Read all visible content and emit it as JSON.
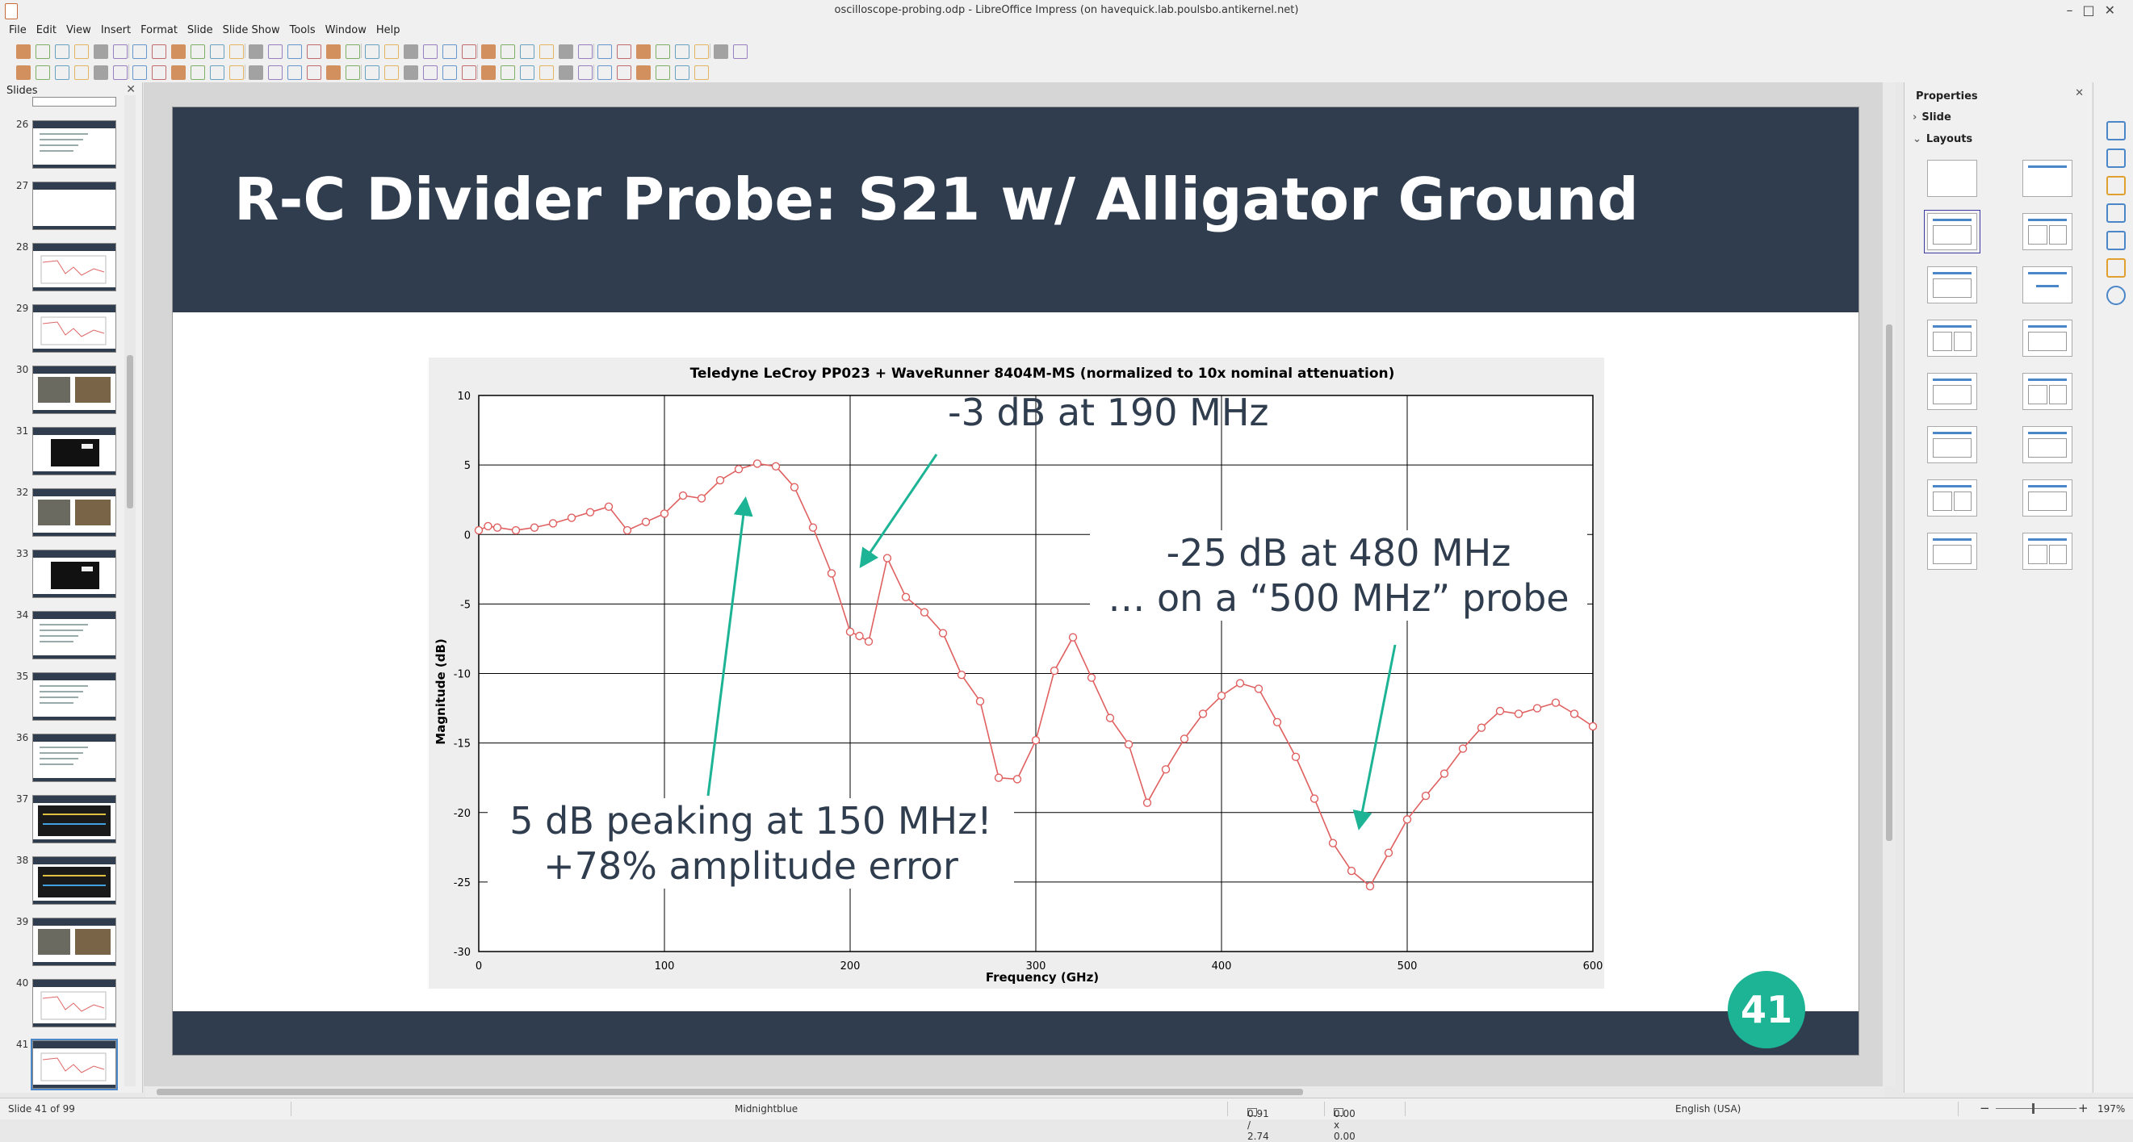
{
  "window": {
    "title": "oscilloscope-probing.odp - LibreOffice Impress (on havequick.lab.poulsbo.antikernel.net)"
  },
  "menu": [
    "File",
    "Edit",
    "View",
    "Insert",
    "Format",
    "Slide",
    "Slide Show",
    "Tools",
    "Window",
    "Help"
  ],
  "slides_pane": {
    "title": "Slides",
    "thumbnails": [
      {
        "num": "26",
        "variant": "text"
      },
      {
        "num": "27",
        "variant": "blank"
      },
      {
        "num": "28",
        "variant": "chart"
      },
      {
        "num": "29",
        "variant": "chart"
      },
      {
        "num": "30",
        "variant": "photo"
      },
      {
        "num": "31",
        "variant": "dark"
      },
      {
        "num": "32",
        "variant": "photo"
      },
      {
        "num": "33",
        "variant": "dark"
      },
      {
        "num": "34",
        "variant": "text"
      },
      {
        "num": "35",
        "variant": "text"
      },
      {
        "num": "36",
        "variant": "text"
      },
      {
        "num": "37",
        "variant": "scope"
      },
      {
        "num": "38",
        "variant": "scope"
      },
      {
        "num": "39",
        "variant": "photo"
      },
      {
        "num": "40",
        "variant": "chart"
      },
      {
        "num": "41",
        "variant": "chart"
      }
    ]
  },
  "slide": {
    "title": "R-C Divider Probe: S21 w/ Alligator Ground",
    "page_number": "41",
    "header_color": "#2f3d4e",
    "accent_color": "#1db495",
    "callouts": {
      "c1": "-3 dB at 190 MHz",
      "c2_line1": "-25 dB at 480 MHz",
      "c2_line2": "… on a “500 MHz” probe",
      "c3_line1": "5 dB peaking at 150 MHz!",
      "c3_line2": "+78% amplitude error"
    }
  },
  "chart_data": {
    "type": "line",
    "title": "Teledyne LeCroy PP023 + WaveRunner 8404M-MS (normalized to 10x nominal attenuation)",
    "xlabel": "Frequency (GHz)",
    "ylabel": "Magnitude (dB)",
    "xlim": [
      0,
      600
    ],
    "ylim": [
      -30,
      10
    ],
    "xticks": [
      0,
      100,
      200,
      300,
      400,
      500,
      600
    ],
    "yticks": [
      10,
      5,
      0,
      -5,
      -10,
      -15,
      -20,
      -25,
      -30
    ],
    "grid": true,
    "line_color": "#e06060",
    "series": [
      {
        "x": [
          0,
          5,
          10,
          20,
          30,
          40,
          50,
          60,
          70,
          80,
          90,
          100,
          110,
          120,
          130,
          140,
          150,
          160,
          170,
          180,
          190,
          200,
          205,
          210,
          220,
          230,
          240,
          250,
          260,
          270,
          280,
          290,
          300,
          310,
          320,
          330,
          340,
          350,
          360,
          370,
          380,
          390,
          400,
          410,
          420,
          430,
          440,
          450,
          460,
          470,
          480,
          490,
          500,
          510,
          520,
          530,
          540,
          550,
          560,
          570,
          580,
          590,
          600
        ],
        "y": [
          0.3,
          0.6,
          0.5,
          0.3,
          0.5,
          0.8,
          1.2,
          1.6,
          2.0,
          0.3,
          0.9,
          1.5,
          2.8,
          2.6,
          3.9,
          4.7,
          5.1,
          4.9,
          3.4,
          0.5,
          -2.8,
          -7.0,
          -7.3,
          -7.7,
          -1.7,
          -4.5,
          -5.6,
          -7.1,
          -10.1,
          -12.0,
          -17.5,
          -17.6,
          -14.8,
          -9.8,
          -7.4,
          -10.3,
          -13.2,
          -15.1,
          -19.3,
          -16.9,
          -14.7,
          -12.9,
          -11.6,
          -10.7,
          -11.1,
          -13.5,
          -16.0,
          -19.0,
          -22.2,
          -24.2,
          -25.3,
          -22.9,
          -20.5,
          -18.8,
          -17.2,
          -15.4,
          -13.9,
          -12.7,
          -12.9,
          -12.5,
          -12.1,
          -12.9,
          -13.8
        ]
      }
    ]
  },
  "sidebar": {
    "title": "Properties",
    "section_slide": "Slide",
    "section_layouts": "Layouts"
  },
  "statusbar": {
    "slide_info": "Slide 41 of 99",
    "master": "Midnightblue",
    "position": "0.91 / 2.74",
    "size": "0.00 x 0.00",
    "language": "English (USA)",
    "zoom": "197%"
  }
}
